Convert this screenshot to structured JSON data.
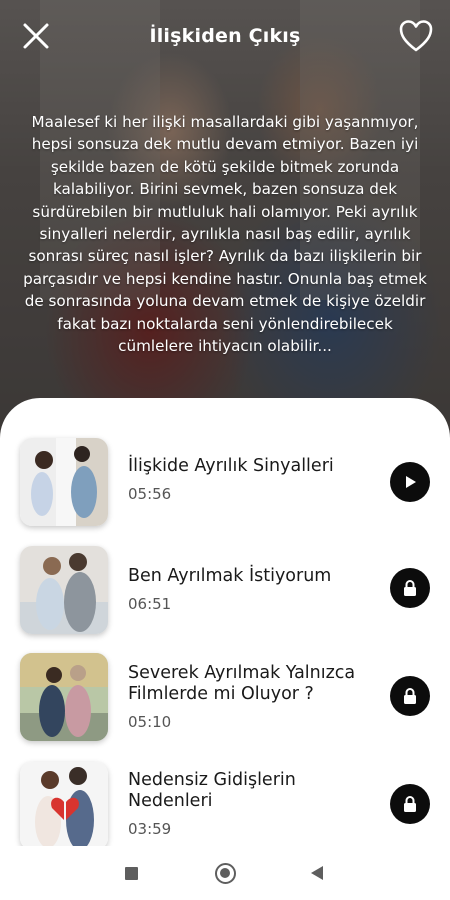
{
  "header": {
    "title": "İlişkiden Çıkış",
    "close_icon": "close-icon",
    "favorite_icon": "heart-outline-icon"
  },
  "description": "Maalesef ki her ilişki masallardaki gibi yaşanmıyor, hepsi sonsuza dek mutlu devam etmiyor. Bazen iyi şekilde bazen de kötü şekilde bitmek zorunda kalabiliyor. Birini sevmek, bazen sonsuza dek sürdürebilen bir mutluluk hali olamıyor. Peki ayrılık sinyalleri nelerdir, ayrılıkla nasıl baş edilir, ayrılık sonrası süreç nasıl işler? Ayrılık da bazı ilişkilerin bir parçasıdır ve hepsi kendine hastır. Onunla baş etmek de sonrasında yoluna devam etmek de kişiye özeldir fakat bazı noktalarda seni yönlendirebilecek cümlelere ihtiyacın olabilir...",
  "episodes": [
    {
      "title": "İlişkide Ayrılık Sinyalleri",
      "duration": "05:56",
      "action_icon": "play-icon"
    },
    {
      "title": "Ben Ayrılmak İstiyorum",
      "duration": "06:51",
      "action_icon": "lock-icon"
    },
    {
      "title": "Severek Ayrılmak Yalnızca Filmlerde mi Oluyor ?",
      "duration": "05:10",
      "action_icon": "lock-icon"
    },
    {
      "title": "Nedensiz Gidişlerin Nedenleri",
      "duration": "03:59",
      "action_icon": "lock-icon"
    }
  ],
  "colors": {
    "sheet_background": "#ffffff",
    "action_button": "#0c0c0c",
    "text_primary": "#1a1a1a",
    "text_secondary": "#555555"
  },
  "navbar": {
    "recent_icon": "square-icon",
    "home_icon": "circle-icon",
    "back_icon": "triangle-back-icon"
  }
}
